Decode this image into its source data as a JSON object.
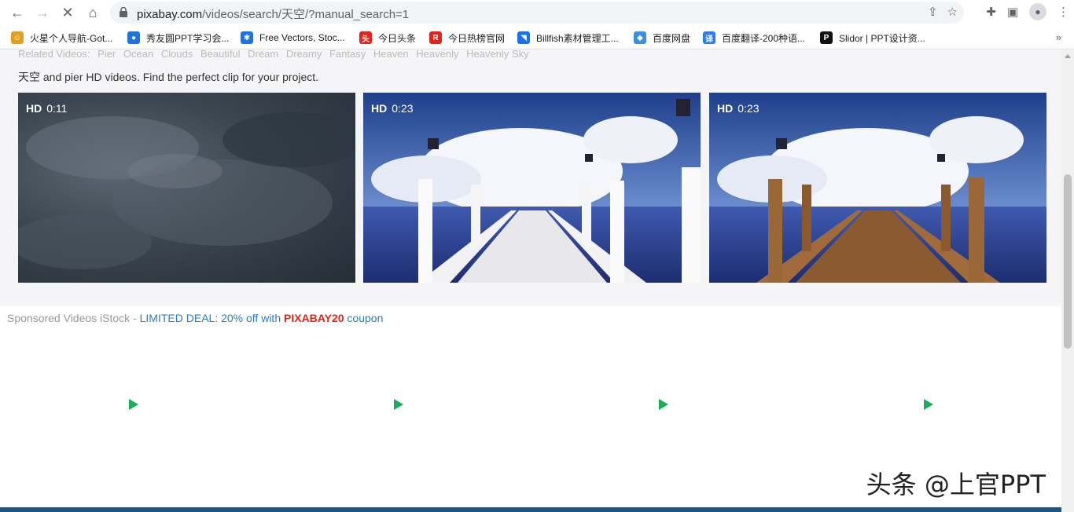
{
  "browser": {
    "url_host": "pixabay.com",
    "url_path": "/videos/search/天空/?manual_search=1"
  },
  "bookmarks": [
    {
      "label": "火星个人导航-Got...",
      "color": "#e0a020",
      "glyph": "☺"
    },
    {
      "label": "秀友圆PPT学习会...",
      "color": "#1a73e8",
      "glyph": "●"
    },
    {
      "label": "Free Vectors, Stoc...",
      "color": "#1a73e8",
      "glyph": "✱"
    },
    {
      "label": "今日头条",
      "color": "#e2231a",
      "glyph": "头"
    },
    {
      "label": "今日热榜官网",
      "color": "#e2231a",
      "glyph": "R"
    },
    {
      "label": "Billfish素材管理工...",
      "color": "#1a73e8",
      "glyph": "◥"
    },
    {
      "label": "百度网盘",
      "color": "#3b8fe0",
      "glyph": "◆"
    },
    {
      "label": "百度翻译-200种语...",
      "color": "#2f7bf0",
      "glyph": "译"
    },
    {
      "label": "Slidor | PPT设计资...",
      "color": "#111111",
      "glyph": "P"
    }
  ],
  "related": {
    "label": "Related Videos:",
    "tags": [
      "Pier",
      "Ocean",
      "Clouds",
      "Beautiful",
      "Dream",
      "Dreamy",
      "Fantasy",
      "Heaven",
      "Heavenly",
      "Heavenly Sky"
    ]
  },
  "description": "天空 and pier HD videos. Find the perfect clip for your project.",
  "videos": [
    {
      "quality": "HD",
      "duration": "0:11"
    },
    {
      "quality": "HD",
      "duration": "0:23"
    },
    {
      "quality": "HD",
      "duration": "0:23"
    }
  ],
  "sponsored": {
    "prefix": "Sponsored Videos iStock - ",
    "deal": "LIMITED DEAL: 20% off with ",
    "code": "PIXABAY20",
    "suffix": " coupon"
  },
  "watermark": "头条 @上官PPT",
  "colors": {
    "accent_green": "#1aad5a",
    "deal_blue": "#2b7bc5",
    "coupon_red": "#e2231a"
  }
}
